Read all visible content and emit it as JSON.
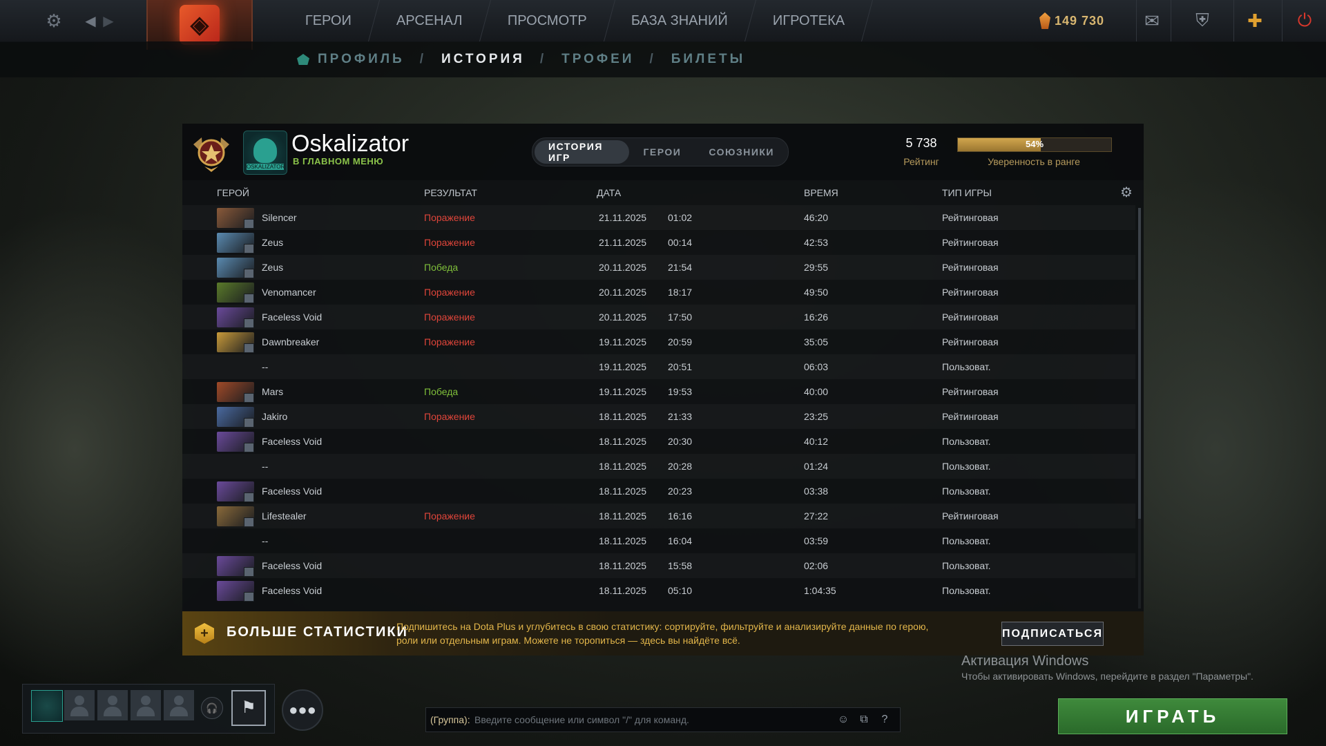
{
  "topbar": {
    "nav": [
      "ГЕРОИ",
      "АРСЕНАЛ",
      "ПРОСМОТР",
      "БАЗА ЗНАНИЙ",
      "ИГРОТЕКА"
    ],
    "currency": "149 730"
  },
  "subnav": {
    "items": [
      {
        "label": "ПРОФИЛЬ",
        "active": false
      },
      {
        "label": "ИСТОРИЯ",
        "active": true
      },
      {
        "label": "ТРОФЕИ",
        "active": false
      },
      {
        "label": "БИЛЕТЫ",
        "active": false
      }
    ],
    "separator": "/"
  },
  "profile": {
    "name": "Oskalizator",
    "status": "В ГЛАВНОМ МЕНЮ",
    "avatar_text": "OSKALIZATOR",
    "tabs": [
      "ИСТОРИЯ ИГР",
      "ГЕРОИ",
      "СОЮЗНИКИ"
    ],
    "rating_value": "5 738",
    "rating_label": "Рейтинг",
    "confidence_pct": "54%",
    "confidence_fraction": 0.54,
    "confidence_label": "Уверенность в ранге"
  },
  "table": {
    "headers": [
      "ГЕРОЙ",
      "РЕЗУЛЬТАТ",
      "ДАТА",
      "ВРЕМЯ",
      "ТИП ИГРЫ"
    ],
    "rows": [
      {
        "hero": "Silencer",
        "result": "Поражение",
        "date": "21.11.2025",
        "time": "01:02",
        "duration": "46:20",
        "type": "Рейтинговая",
        "color": "#8a5a3a"
      },
      {
        "hero": "Zeus",
        "result": "Поражение",
        "date": "21.11.2025",
        "time": "00:14",
        "duration": "42:53",
        "type": "Рейтинговая",
        "color": "#5a8ab0"
      },
      {
        "hero": "Zeus",
        "result": "Победа",
        "date": "20.11.2025",
        "time": "21:54",
        "duration": "29:55",
        "type": "Рейтинговая",
        "color": "#5a8ab0"
      },
      {
        "hero": "Venomancer",
        "result": "Поражение",
        "date": "20.11.2025",
        "time": "18:17",
        "duration": "49:50",
        "type": "Рейтинговая",
        "color": "#5a7a2a"
      },
      {
        "hero": "Faceless Void",
        "result": "Поражение",
        "date": "20.11.2025",
        "time": "17:50",
        "duration": "16:26",
        "type": "Рейтинговая",
        "color": "#6a4a9a"
      },
      {
        "hero": "Dawnbreaker",
        "result": "Поражение",
        "date": "19.11.2025",
        "time": "20:59",
        "duration": "35:05",
        "type": "Рейтинговая",
        "color": "#c89a3a"
      },
      {
        "hero": "--",
        "result": "",
        "date": "19.11.2025",
        "time": "20:51",
        "duration": "06:03",
        "type": "Пользоват.",
        "color": ""
      },
      {
        "hero": "Mars",
        "result": "Победа",
        "date": "19.11.2025",
        "time": "19:53",
        "duration": "40:00",
        "type": "Рейтинговая",
        "color": "#a04a28"
      },
      {
        "hero": "Jakiro",
        "result": "Поражение",
        "date": "18.11.2025",
        "time": "21:33",
        "duration": "23:25",
        "type": "Рейтинговая",
        "color": "#4a6aa0"
      },
      {
        "hero": "Faceless Void",
        "result": "",
        "date": "18.11.2025",
        "time": "20:30",
        "duration": "40:12",
        "type": "Пользоват.",
        "color": "#6a4a9a"
      },
      {
        "hero": "--",
        "result": "",
        "date": "18.11.2025",
        "time": "20:28",
        "duration": "01:24",
        "type": "Пользоват.",
        "color": ""
      },
      {
        "hero": "Faceless Void",
        "result": "",
        "date": "18.11.2025",
        "time": "20:23",
        "duration": "03:38",
        "type": "Пользоват.",
        "color": "#6a4a9a"
      },
      {
        "hero": "Lifestealer",
        "result": "Поражение",
        "date": "18.11.2025",
        "time": "16:16",
        "duration": "27:22",
        "type": "Рейтинговая",
        "color": "#8a6a3a"
      },
      {
        "hero": "--",
        "result": "",
        "date": "18.11.2025",
        "time": "16:04",
        "duration": "03:59",
        "type": "Пользоват.",
        "color": ""
      },
      {
        "hero": "Faceless Void",
        "result": "",
        "date": "18.11.2025",
        "time": "15:58",
        "duration": "02:06",
        "type": "Пользоват.",
        "color": "#6a4a9a"
      },
      {
        "hero": "Faceless Void",
        "result": "",
        "date": "18.11.2025",
        "time": "05:10",
        "duration": "1:04:35",
        "type": "Пользоват.",
        "color": "#6a4a9a"
      }
    ]
  },
  "promo": {
    "title": "БОЛЬШЕ СТАТИСТИКИ",
    "text": "Подпишитесь на Dota Plus и углубитесь в свою статистику: сортируйте, фильтруйте и анализируйте данные по герою, роли или отдельным играм. Можете не торопиться — здесь вы найдёте всё.",
    "button": "ПОДПИСАТЬСЯ"
  },
  "windows": {
    "title": "Активация Windows",
    "text": "Чтобы активировать Windows, перейдите в раздел \"Параметры\"."
  },
  "chat": {
    "label": "(Группа):",
    "placeholder": "Введите сообщение или символ \"/\" для команд."
  },
  "play_label": "ИГРАТЬ"
}
